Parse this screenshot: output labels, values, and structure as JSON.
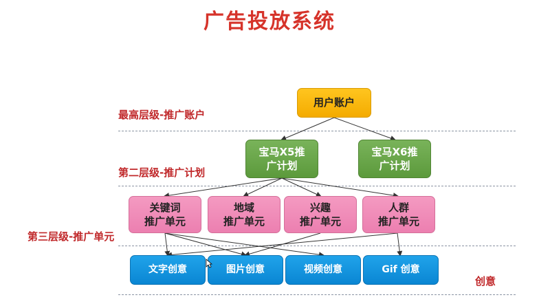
{
  "title": "广告投放系统",
  "levels": {
    "level1": "最高层级-推广账户",
    "level2": "第二层级-推广计划",
    "level3": "第三层级-推广单元",
    "creative": "创意"
  },
  "nodes": {
    "account": "用户账户",
    "plans": [
      {
        "line1": "宝马X5推",
        "line2": "广计划"
      },
      {
        "line1": "宝马X6推",
        "line2": "广计划"
      }
    ],
    "units": [
      {
        "line1": "关键词",
        "line2": "推广单元"
      },
      {
        "line1": "地域",
        "line2": "推广单元"
      },
      {
        "line1": "兴趣",
        "line2": "推广单元"
      },
      {
        "line1": "人群",
        "line2": "推广单元"
      }
    ],
    "creatives": [
      "文字创意",
      "图片创意",
      "视频创意",
      "Gif 创意"
    ]
  },
  "colors": {
    "title": "#d6332a",
    "label": "#c0282a",
    "account": "#f4ab00",
    "plan": "#5c9a3c",
    "unit": "#ec7fb0",
    "creative": "#0a86d3"
  }
}
